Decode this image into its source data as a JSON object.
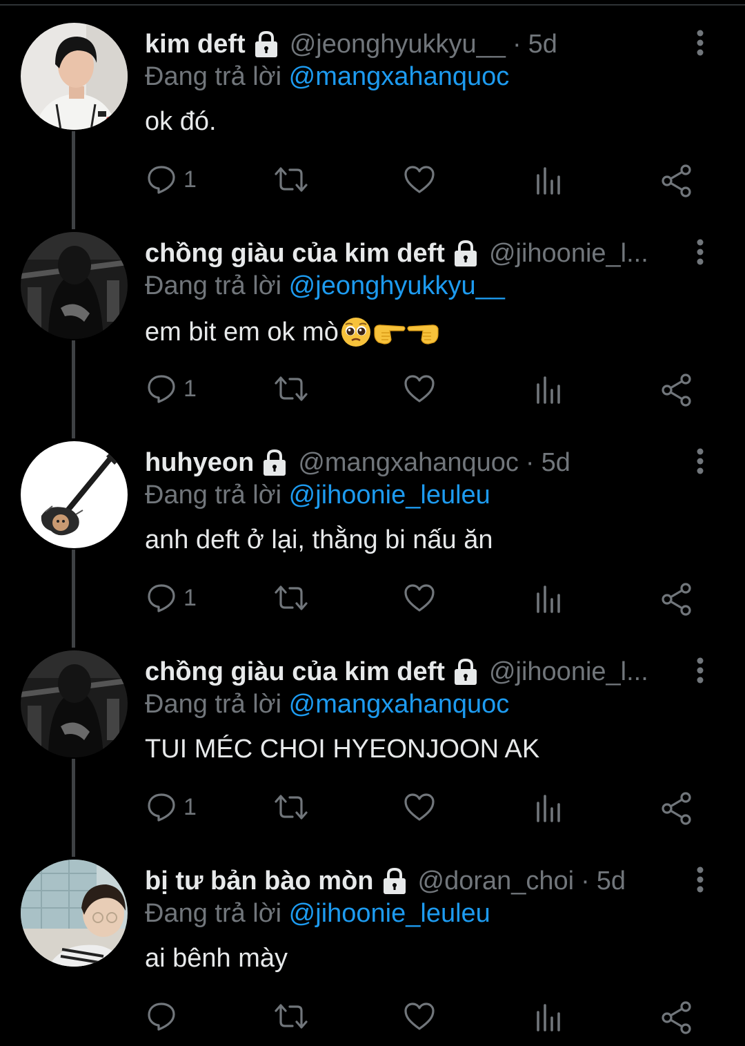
{
  "thread": {
    "tweets": [
      {
        "name": "kim deft",
        "handle": "@jeonghyukkyu__",
        "dot": "·",
        "time": "5d",
        "reply_prefix": "Đang trả lời",
        "reply_to": "@mangxahanquoc",
        "text": "ok đó.",
        "reply_count": "1"
      },
      {
        "name": "chồng giàu của kim deft",
        "handle": "@jihoonie_l...",
        "dot": "",
        "time": "",
        "reply_prefix": "Đang trả lời",
        "reply_to": "@jeonghyukkyu__",
        "text": "em bit em ok mò",
        "emojis": [
          "pleading-face-emoji",
          "backhand-pointing-right-emoji",
          "backhand-pointing-left-emoji"
        ],
        "reply_count": "1"
      },
      {
        "name": "huhyeon",
        "handle": "@mangxahanquoc",
        "dot": "·",
        "time": "5d",
        "reply_prefix": "Đang trả lời",
        "reply_to": "@jihoonie_leuleu",
        "text": "anh deft ở lại, thằng bi nấu ăn",
        "reply_count": "1"
      },
      {
        "name": "chồng giàu của kim deft",
        "handle": "@jihoonie_l...",
        "dot": "",
        "time": "",
        "reply_prefix": "Đang trả lời",
        "reply_to": "@mangxahanquoc",
        "text": "TUI MÉC CHOI HYEONJOON AK",
        "reply_count": "1"
      },
      {
        "name": "bị tư bản bào mòn",
        "handle": "@doran_choi",
        "dot": "·",
        "time": "5d",
        "reply_prefix": "Đang trả lời",
        "reply_to": "@jihoonie_leuleu",
        "text": "ai bênh mày",
        "reply_count": ""
      }
    ]
  },
  "icons": {
    "lock": "lock-icon",
    "more": "more-vertical-icon",
    "reply": "reply-bubble-icon",
    "retweet": "retweet-icon",
    "like": "heart-icon",
    "views": "views-chart-icon",
    "share": "share-icon"
  },
  "colors": {
    "background": "#000000",
    "text": "#e7e9ea",
    "secondary": "#71767b",
    "link": "#1d9bf0",
    "thread_line": "#3e4144"
  }
}
